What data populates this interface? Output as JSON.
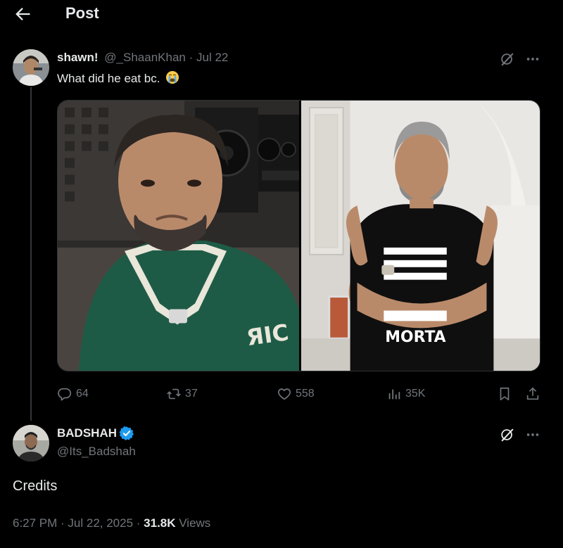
{
  "header": {
    "title": "Post"
  },
  "tweet1": {
    "author_name": "shawn!",
    "handle": "@_ShaanKhan",
    "separator": "·",
    "date": "Jul 22",
    "text": "What did he eat bc.",
    "emoji_icon": "loudly-crying-face-emoji",
    "stats": {
      "replies": "64",
      "reposts": "37",
      "likes": "558",
      "views": "35K"
    }
  },
  "tweet2": {
    "author_name": "BADSHAH",
    "handle": "@Its_Badshah",
    "text": "Credits",
    "verified_color": "#1d9bf0",
    "timestamp": "6:27 PM · Jul 22, 2025 · ",
    "views_count": "31.8K",
    "views_label": " Views"
  },
  "colors": {
    "background": "#000000",
    "text": "#e7e9ea",
    "muted": "#71767b",
    "accent": "#1d9bf0"
  }
}
